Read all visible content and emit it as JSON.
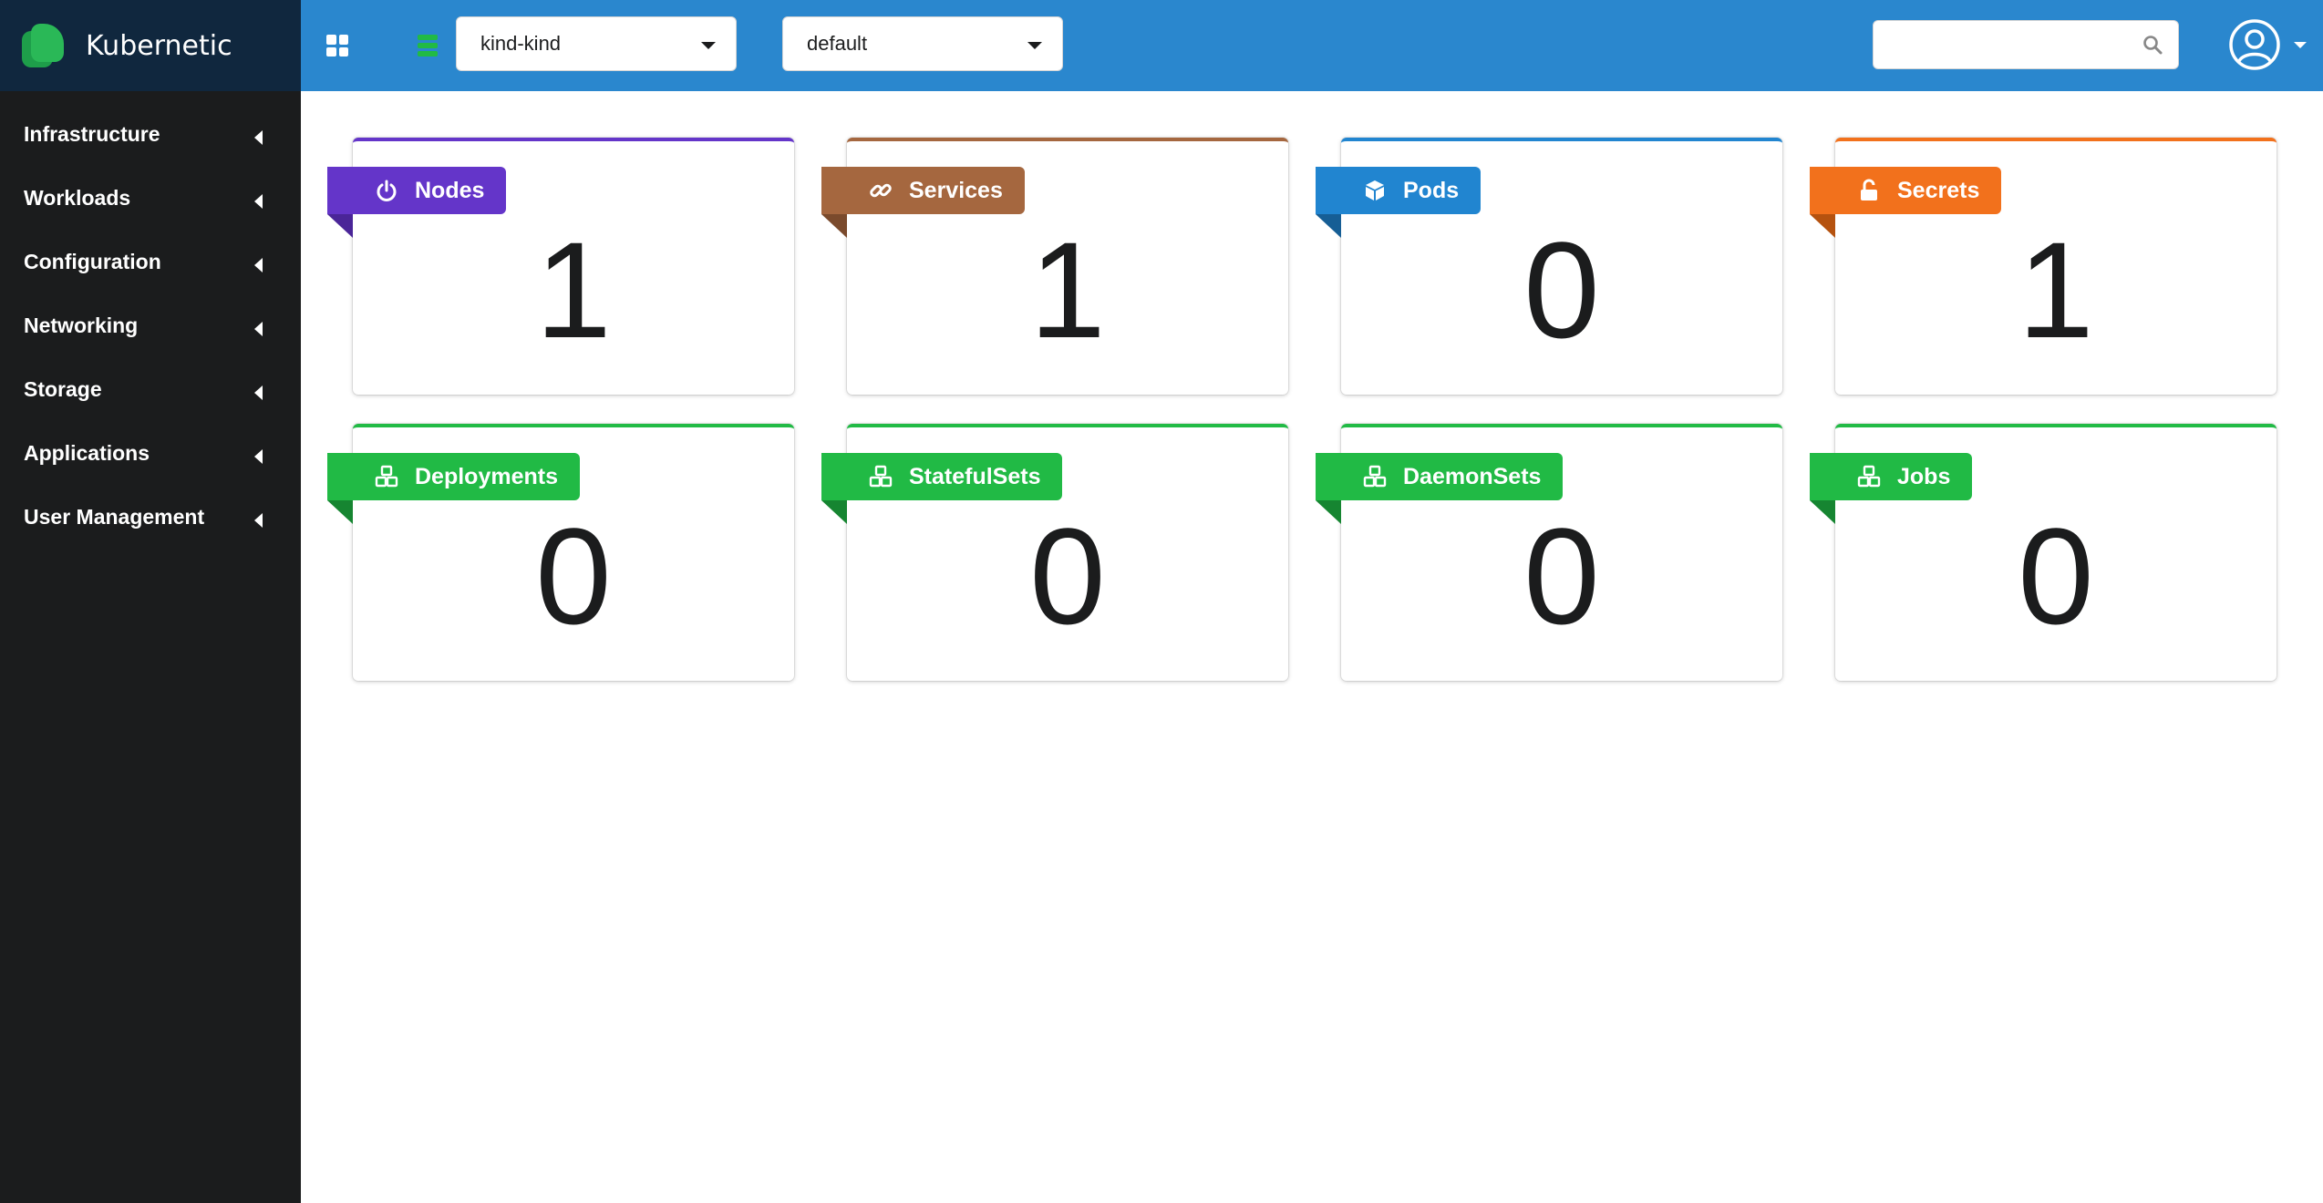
{
  "brand": {
    "name": "Kubernetic"
  },
  "sidebar": {
    "items": [
      {
        "label": "Infrastructure"
      },
      {
        "label": "Workloads"
      },
      {
        "label": "Configuration"
      },
      {
        "label": "Networking"
      },
      {
        "label": "Storage"
      },
      {
        "label": "Applications"
      },
      {
        "label": "User Management"
      }
    ]
  },
  "topbar": {
    "cluster": "kind-kind",
    "namespace": "default",
    "search_placeholder": ""
  },
  "cards": [
    {
      "label": "Nodes",
      "count": "1",
      "color": "#6435c9",
      "icon": "power-icon"
    },
    {
      "label": "Services",
      "count": "1",
      "color": "#a5673f",
      "icon": "link-icon"
    },
    {
      "label": "Pods",
      "count": "0",
      "color": "#2185d0",
      "icon": "cube-icon"
    },
    {
      "label": "Secrets",
      "count": "1",
      "color": "#f2711c",
      "icon": "unlock-icon"
    },
    {
      "label": "Deployments",
      "count": "0",
      "color": "#21ba45",
      "icon": "cubes-icon"
    },
    {
      "label": "StatefulSets",
      "count": "0",
      "color": "#21ba45",
      "icon": "cubes-icon"
    },
    {
      "label": "DaemonSets",
      "count": "0",
      "color": "#21ba45",
      "icon": "cubes-icon"
    },
    {
      "label": "Jobs",
      "count": "0",
      "color": "#21ba45",
      "icon": "cubes-icon"
    }
  ]
}
